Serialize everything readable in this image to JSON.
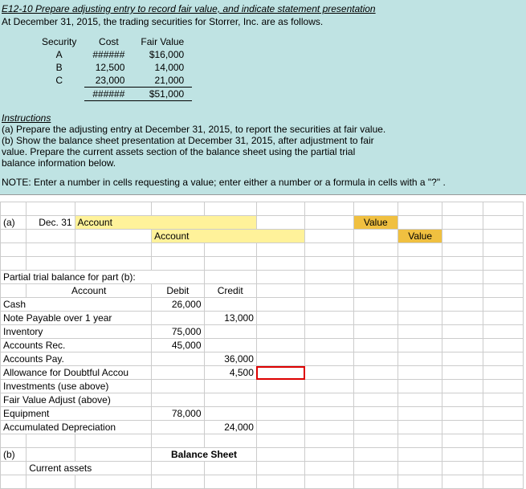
{
  "title": "E12-10  Prepare adjusting entry to record fair value, and indicate statement presentation",
  "intro": "At December 31, 2015, the trading securities for Storrer, Inc. are as follows.",
  "sec_table": {
    "headers": [
      "Security",
      "Cost",
      "Fair Value"
    ],
    "rows": [
      {
        "sec": "A",
        "cost": "######",
        "fv": "$16,000"
      },
      {
        "sec": "B",
        "cost": "12,500",
        "fv": "14,000"
      },
      {
        "sec": "C",
        "cost": "23,000",
        "fv": "21,000"
      }
    ],
    "total": {
      "cost": "######",
      "fv": "$51,000"
    }
  },
  "instr_head": "Instructions",
  "instr_a": "(a)  Prepare the adjusting entry at December 31, 2015, to report the securities at fair value.",
  "instr_b1": "(b)  Show the balance sheet presentation at December 31, 2015, after adjustment to fair",
  "instr_b2": "value.  Prepare the current assets section of the balance sheet using the partial trial",
  "instr_b3": "balance information below.",
  "note": "NOTE:  Enter a number in cells requesting a value; enter either a number or a formula in cells with a \"?\" .",
  "part_a": {
    "label": "(a)",
    "date": "Dec. 31",
    "account_label": "Account",
    "value_label": "Value"
  },
  "ptb": {
    "heading": "Partial trial balance for part (b):",
    "cols": {
      "acct": "Account",
      "debit": "Debit",
      "credit": "Credit"
    },
    "rows": [
      {
        "acct": "Cash",
        "debit": "26,000",
        "credit": ""
      },
      {
        "acct": "Note Payable over 1 year",
        "debit": "",
        "credit": "13,000"
      },
      {
        "acct": "Inventory",
        "debit": "75,000",
        "credit": ""
      },
      {
        "acct": "Accounts Rec.",
        "debit": "45,000",
        "credit": ""
      },
      {
        "acct": "Accounts Pay.",
        "debit": "",
        "credit": "36,000"
      },
      {
        "acct": "Allowance for Doubtful Accou",
        "debit": "",
        "credit": "4,500"
      },
      {
        "acct": "Investments (use above)",
        "debit": "",
        "credit": ""
      },
      {
        "acct": "Fair Value Adjust (above)",
        "debit": "",
        "credit": ""
      },
      {
        "acct": "Equipment",
        "debit": "78,000",
        "credit": ""
      },
      {
        "acct": "Accumulated Depreciation",
        "debit": "",
        "credit": "24,000"
      }
    ]
  },
  "part_b": {
    "label": "(b)",
    "bs_title": "Balance Sheet",
    "current_assets": "Current assets"
  }
}
